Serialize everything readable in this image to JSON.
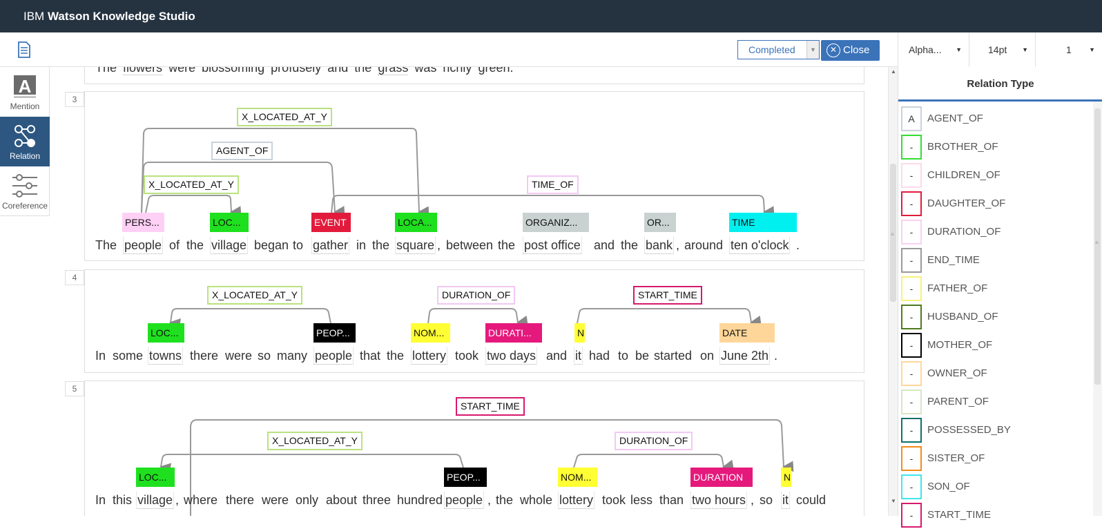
{
  "app": {
    "brand": "IBM",
    "product": "Watson Knowledge Studio"
  },
  "toolbar": {
    "status": "Completed",
    "close_label": "Close",
    "sort_value": "Alpha...",
    "font_size": "14pt",
    "page_value": "1"
  },
  "leftnav": {
    "items": [
      {
        "label": "Mention",
        "icon": "letter-a-icon",
        "active": false
      },
      {
        "label": "Relation",
        "icon": "relation-nodes-icon",
        "active": true
      },
      {
        "label": "Coreference",
        "icon": "sliders-icon",
        "active": false
      }
    ]
  },
  "prev_sentence": {
    "text": [
      "The",
      "flowers",
      "were",
      "blossoming",
      "profusely",
      "and",
      "the",
      "grass",
      "was",
      "richly",
      "green."
    ]
  },
  "sentences": [
    {
      "number": "3",
      "words": [
        "The",
        "people",
        "of",
        "the",
        "village",
        "began",
        "to",
        "gather",
        "in",
        "the",
        "square",
        ",",
        "between",
        "the",
        "post office",
        "and",
        "the",
        "bank",
        ",",
        "around",
        "ten o'clock",
        "."
      ],
      "entities": [
        "PERS...",
        "LOC...",
        "EVENT",
        "LOCA...",
        "ORGANIZ...",
        "OR...",
        "TIME"
      ],
      "relations": [
        "X_LOCATED_AT_Y",
        "AGENT_OF",
        "X_LOCATED_AT_Y",
        "TIME_OF"
      ]
    },
    {
      "number": "4",
      "words": [
        "In",
        "some",
        "towns",
        "there",
        "were",
        "so",
        "many",
        "people",
        "that",
        "the",
        "lottery",
        "took",
        "two days",
        "and",
        "it",
        "had",
        "to",
        "be",
        "started",
        "on",
        "June 2th",
        "."
      ],
      "entities": [
        "LOC...",
        "PEOP...",
        "NOM...",
        "DURATI...",
        "N",
        "DATE"
      ],
      "relations": [
        "X_LOCATED_AT_Y",
        "DURATION_OF",
        "START_TIME"
      ]
    },
    {
      "number": "5",
      "words": [
        "In",
        "this",
        "village",
        ",",
        "where",
        "there",
        "were",
        "only",
        "about",
        "three",
        "hundred",
        "people",
        ",",
        "the",
        "whole",
        "lottery",
        "took",
        "less",
        "than",
        "two hours",
        ",",
        "so",
        "it",
        "could"
      ],
      "entities": [
        "LOC...",
        "PEOP...",
        "NOM...",
        "DURATION",
        "N"
      ],
      "relations": [
        "START_TIME",
        "X_LOCATED_AT_Y",
        "DURATION_OF"
      ]
    }
  ],
  "relation_panel": {
    "title": "Relation Type",
    "items": [
      {
        "key": "A",
        "name": "AGENT_OF",
        "color": "#c8d2dc"
      },
      {
        "key": "-",
        "name": "BROTHER_OF",
        "color": "#33dd33"
      },
      {
        "key": "-",
        "name": "CHILDREN_OF",
        "color": "#ffd9ea"
      },
      {
        "key": "-",
        "name": "DAUGHTER_OF",
        "color": "#e21b3c"
      },
      {
        "key": "-",
        "name": "DURATION_OF",
        "color": "#f9d0f0"
      },
      {
        "key": "-",
        "name": "END_TIME",
        "color": "#999999"
      },
      {
        "key": "-",
        "name": "FATHER_OF",
        "color": "#f6f27a"
      },
      {
        "key": "-",
        "name": "HUSBAND_OF",
        "color": "#4d7a1e"
      },
      {
        "key": "-",
        "name": "MOTHER_OF",
        "color": "#000000"
      },
      {
        "key": "-",
        "name": "OWNER_OF",
        "color": "#ffd79c"
      },
      {
        "key": "-",
        "name": "PARENT_OF",
        "color": "#d7e6c6"
      },
      {
        "key": "-",
        "name": "POSSESSED_BY",
        "color": "#0f6e6e"
      },
      {
        "key": "-",
        "name": "SISTER_OF",
        "color": "#f38a1c"
      },
      {
        "key": "-",
        "name": "SON_OF",
        "color": "#3ee6ec"
      },
      {
        "key": "-",
        "name": "START_TIME",
        "color": "#d6196e"
      }
    ]
  },
  "colors": {
    "topbar": "#253341",
    "accent": "#3b73b9",
    "nav_active": "#2d5781",
    "loc": "#1ee01e",
    "person": "#ffd0f6",
    "event": "#e21b3c",
    "org": "#c9d1d1",
    "time": "#00f0f0",
    "people": "#000000",
    "nom": "#ffff33",
    "duration": "#e5197c",
    "date": "#ffd699"
  }
}
